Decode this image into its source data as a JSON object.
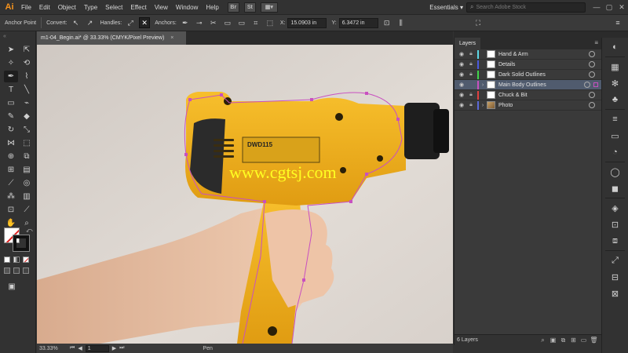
{
  "app": {
    "logo": "Ai",
    "menu": [
      "File",
      "Edit",
      "Object",
      "Type",
      "Select",
      "Effect",
      "View",
      "Window",
      "Help"
    ],
    "bridge_label": "Br",
    "stock_label": "St",
    "workspace": "Essentials ▾",
    "search_placeholder": "Search Adobe Stock",
    "win_min": "—",
    "win_max": "▢",
    "win_close": "✕"
  },
  "control_bar": {
    "tool_name": "Anchor Point",
    "convert_label": "Convert:",
    "handles_label": "Handles:",
    "anchors_label": "Anchors:",
    "x_label": "X:",
    "x_value": "15.0903 in",
    "y_label": "Y:",
    "y_value": "6.3472 in"
  },
  "document": {
    "tab_title": "m1-04_Begin.ai* @ 33.33% (CMYK/Pixel Preview)",
    "close": "×",
    "watermark": "www.cgtsj.com",
    "drill_label": "DWD115"
  },
  "status_bar": {
    "zoom": "33.33%",
    "page": "1",
    "tool": "Pen"
  },
  "layers": {
    "tab": "Layers",
    "menu_icon": "≡",
    "count_label": "6 Layers",
    "items": [
      {
        "name": "Hand & Arm",
        "color": "#5cd8e6",
        "selected": false,
        "expandable": false,
        "photo": false
      },
      {
        "name": "Details",
        "color": "#4a5adf",
        "selected": false,
        "expandable": false,
        "photo": false
      },
      {
        "name": "Dark Solid Outlines",
        "color": "#3fd64a",
        "selected": false,
        "expandable": false,
        "photo": false
      },
      {
        "name": "Main Body Outlines",
        "color": "#c850c0",
        "selected": true,
        "expandable": true,
        "photo": false
      },
      {
        "name": "Chuck & Bit",
        "color": "#e04040",
        "selected": false,
        "expandable": false,
        "photo": false
      },
      {
        "name": "Photo",
        "color": "#5b69d8",
        "selected": false,
        "expandable": true,
        "photo": true
      }
    ]
  },
  "colors": {
    "accent_selection": "#c850c0",
    "drill_yellow": "#f2b21c",
    "ui_dark": "#323232"
  }
}
